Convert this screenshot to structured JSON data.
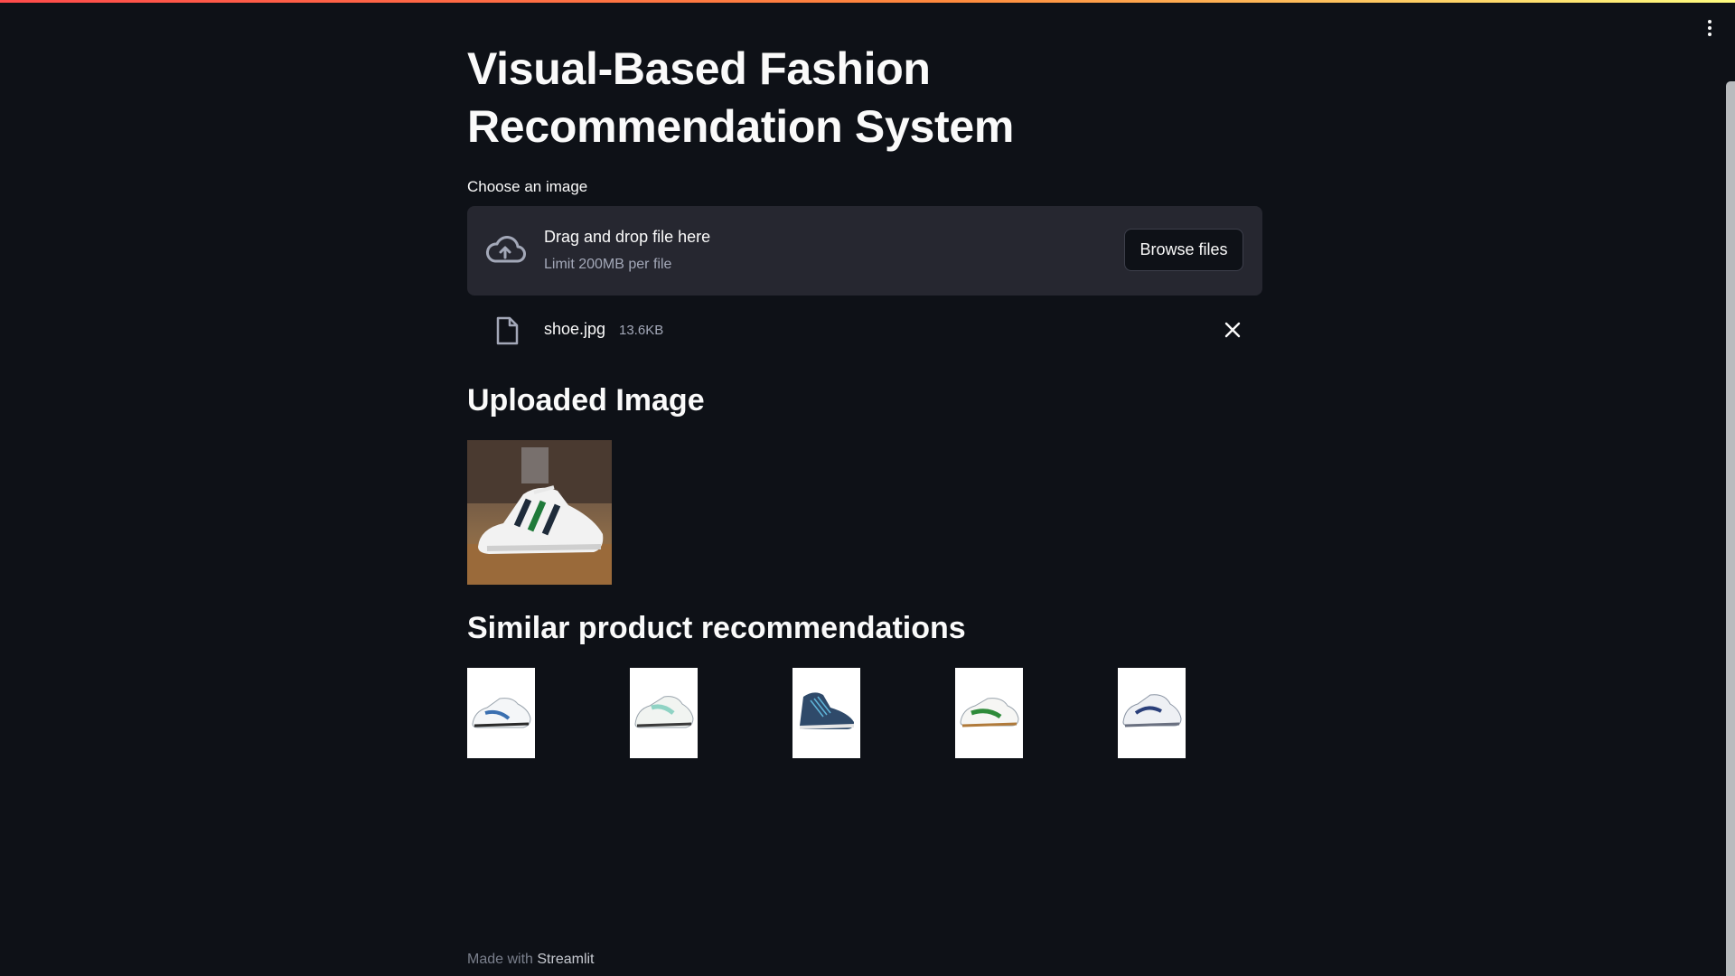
{
  "app": {
    "title": "Visual-Based Fashion Recommendation System",
    "accent_gradient": [
      "#ff4b4b",
      "#ff8a3d",
      "#fffd80"
    ],
    "background": "#0e1117"
  },
  "uploader": {
    "label": "Choose an image",
    "drop_text": "Drag and drop file here",
    "limit_text": "Limit 200MB per file",
    "browse_label": "Browse files",
    "icon": "cloud-upload-icon"
  },
  "uploaded_file": {
    "name": "shoe.jpg",
    "size": "13.6KB",
    "icon": "file-icon"
  },
  "sections": {
    "uploaded_heading": "Uploaded Image",
    "recommendations_heading": "Similar product recommendations"
  },
  "recommendations": [
    {
      "item": "white sneaker with blue accents",
      "accent": "#3a6fb0"
    },
    {
      "item": "white and mint running shoe",
      "accent": "#8fd3c4"
    },
    {
      "item": "dark blue high-top sneaker",
      "accent": "#2f4a6a"
    },
    {
      "item": "white sneaker with green stripe",
      "accent": "#2e8b3a"
    },
    {
      "item": "white and navy running shoe",
      "accent": "#2a3f7a"
    }
  ],
  "footer": {
    "prefix": "Made with",
    "brand": "Streamlit"
  }
}
